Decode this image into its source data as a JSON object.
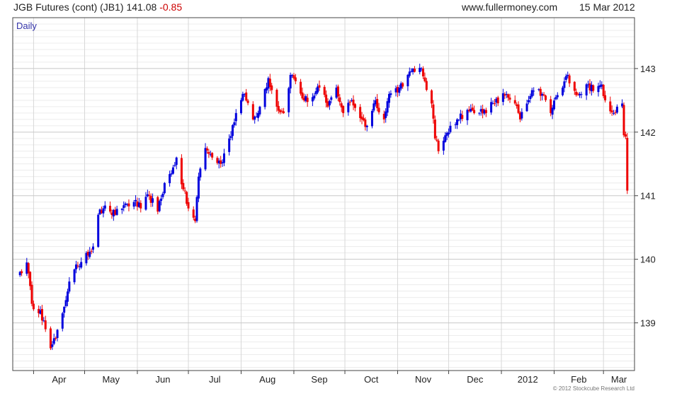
{
  "header": {
    "symbol_text": "JGB Futures (cont) (JB1) 141.08",
    "change_text": "-0.85",
    "site": "www.fullermoney.com",
    "date": "15 Mar 2012"
  },
  "footer": {
    "copyright": "© 2012 Stockcube Research Ltd"
  },
  "colors": {
    "up": "#0000dd",
    "down": "#ee0000",
    "grid": "#d8d8d8",
    "frame": "#444444",
    "label": "#3333aa"
  },
  "chart_data": {
    "type": "candlestick",
    "period_label": "Daily",
    "x_tick_labels": [
      "Apr",
      "May",
      "Jun",
      "Jul",
      "Aug",
      "Sep",
      "Oct",
      "Nov",
      "Dec",
      "2012",
      "Feb",
      "Mar"
    ],
    "y_ticks": [
      139,
      140,
      141,
      142,
      143
    ],
    "ylim": [
      138.25,
      143.8
    ],
    "last_close": 141.08,
    "change": -0.85,
    "anchors": [
      [
        "2011-03-24",
        139.8
      ],
      [
        "2011-03-28",
        139.95
      ],
      [
        "2011-03-31",
        139.3
      ],
      [
        "2011-04-05",
        139.2
      ],
      [
        "2011-04-08",
        138.9
      ],
      [
        "2011-04-11",
        138.6
      ],
      [
        "2011-04-14",
        138.75
      ],
      [
        "2011-04-18",
        139.15
      ],
      [
        "2011-04-22",
        139.65
      ],
      [
        "2011-04-27",
        139.9
      ],
      [
        "2011-05-02",
        140.1
      ],
      [
        "2011-05-06",
        140.2
      ],
      [
        "2011-05-09",
        140.7
      ],
      [
        "2011-05-12",
        140.8
      ],
      [
        "2011-05-16",
        140.75
      ],
      [
        "2011-05-19",
        140.7
      ],
      [
        "2011-05-24",
        140.85
      ],
      [
        "2011-05-30",
        140.9
      ],
      [
        "2011-06-03",
        140.8
      ],
      [
        "2011-06-08",
        141.0
      ],
      [
        "2011-06-13",
        140.75
      ],
      [
        "2011-06-17",
        141.2
      ],
      [
        "2011-06-21",
        141.35
      ],
      [
        "2011-06-24",
        141.6
      ],
      [
        "2011-06-28",
        141.1
      ],
      [
        "2011-07-01",
        140.8
      ],
      [
        "2011-07-05",
        140.6
      ],
      [
        "2011-07-07",
        141.3
      ],
      [
        "2011-07-11",
        141.75
      ],
      [
        "2011-07-15",
        141.6
      ],
      [
        "2011-07-20",
        141.5
      ],
      [
        "2011-07-25",
        141.9
      ],
      [
        "2011-07-29",
        142.3
      ],
      [
        "2011-08-03",
        142.6
      ],
      [
        "2011-08-08",
        142.2
      ],
      [
        "2011-08-12",
        142.4
      ],
      [
        "2011-08-17",
        142.85
      ],
      [
        "2011-08-22",
        142.4
      ],
      [
        "2011-08-26",
        142.3
      ],
      [
        "2011-08-30",
        142.9
      ],
      [
        "2011-09-02",
        142.8
      ],
      [
        "2011-09-07",
        142.5
      ],
      [
        "2011-09-12",
        142.55
      ],
      [
        "2011-09-16",
        142.7
      ],
      [
        "2011-09-21",
        142.4
      ],
      [
        "2011-09-26",
        142.7
      ],
      [
        "2011-09-30",
        142.3
      ],
      [
        "2011-10-05",
        142.5
      ],
      [
        "2011-10-11",
        142.2
      ],
      [
        "2011-10-14",
        142.1
      ],
      [
        "2011-10-19",
        142.5
      ],
      [
        "2011-10-24",
        142.2
      ],
      [
        "2011-10-27",
        142.6
      ],
      [
        "2011-11-02",
        142.7
      ],
      [
        "2011-11-07",
        142.9
      ],
      [
        "2011-11-11",
        142.95
      ],
      [
        "2011-11-15",
        143.0
      ],
      [
        "2011-11-17",
        142.8
      ],
      [
        "2011-11-21",
        142.45
      ],
      [
        "2011-11-23",
        141.9
      ],
      [
        "2011-11-25",
        141.7
      ],
      [
        "2011-11-29",
        141.95
      ],
      [
        "2011-12-02",
        142.1
      ],
      [
        "2011-12-06",
        142.2
      ],
      [
        "2011-12-12",
        142.35
      ],
      [
        "2011-12-16",
        142.3
      ],
      [
        "2011-12-22",
        142.35
      ],
      [
        "2011-12-28",
        142.45
      ],
      [
        "2012-01-04",
        142.6
      ],
      [
        "2012-01-09",
        142.45
      ],
      [
        "2012-01-12",
        142.2
      ],
      [
        "2012-01-16",
        142.45
      ],
      [
        "2012-01-20",
        142.65
      ],
      [
        "2012-01-25",
        142.6
      ],
      [
        "2012-01-30",
        142.3
      ],
      [
        "2012-02-02",
        142.55
      ],
      [
        "2012-02-06",
        142.7
      ],
      [
        "2012-02-09",
        142.9
      ],
      [
        "2012-02-13",
        142.65
      ],
      [
        "2012-02-16",
        142.6
      ],
      [
        "2012-02-21",
        142.75
      ],
      [
        "2012-02-24",
        142.65
      ],
      [
        "2012-02-29",
        142.75
      ],
      [
        "2012-03-02",
        142.5
      ],
      [
        "2012-03-07",
        142.3
      ],
      [
        "2012-03-09",
        142.4
      ],
      [
        "2012-03-12",
        142.45
      ],
      [
        "2012-03-13",
        141.95
      ],
      [
        "2012-03-14",
        141.93
      ],
      [
        "2012-03-15",
        141.08
      ]
    ],
    "bar_count": 248
  }
}
